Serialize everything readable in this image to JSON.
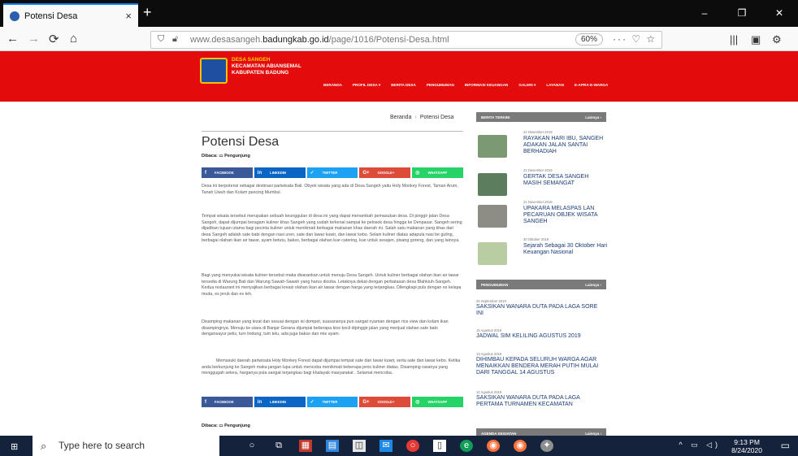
{
  "browser": {
    "tab_title": "Potensi Desa",
    "tab_close": "×",
    "new_tab": "+",
    "window_controls": [
      "–",
      "❐",
      "✕"
    ],
    "nav": {
      "back": "←",
      "forward": "→",
      "reload": "⟳",
      "home": "⌂"
    },
    "url_prefix": "www.desasangeh.",
    "url_domain": "badungkab.go.id",
    "url_path": "/page/1016/Potensi-Desa.html",
    "zoom": "60%",
    "url_actions": "··· ♡ ☆",
    "toolbar_icons": [
      "|||",
      "▣",
      "⚙"
    ]
  },
  "site": {
    "name_line1": "DESA SANGEH",
    "name_line2": "KECAMATAN ABIANSEMAL",
    "name_line3": "KABUPATEN BADUNG",
    "menu": [
      "BERANDA",
      "PROFIL DESA ▾",
      "BERITA DESA",
      "PENGUMUMAN",
      "INFORMASI KEUANGAN",
      "GALERI ▾",
      "LAYANAN",
      "E-APRA-E-WARGA"
    ],
    "accent_color": "#e30b0b"
  },
  "article": {
    "breadcrumb_home": "Beranda",
    "breadcrumb_sep": "›",
    "breadcrumb_current": "Potensi Desa",
    "title": "Potensi Desa",
    "view_label": "Dibaca: ▭ Pengunjung",
    "share": [
      {
        "icon": "f",
        "label": "FACEBOOK"
      },
      {
        "icon": "in",
        "label": "LINKEDIN"
      },
      {
        "icon": "✓",
        "label": "TWITTER"
      },
      {
        "icon": "G+",
        "label": "GOOGLE+"
      },
      {
        "icon": "◎",
        "label": "WHATSAPP"
      }
    ],
    "paragraphs": [
      "Desa ini berpotensi sebagai destinasi pariwisata Bali. Obyek wisata yang ada di Desa Sangeh yaitu Holy Monkey Forest, Taman Arum, Tanah Uwuh dan Kolam pancing Mumbul.",
      "Tempat wisata tersebut merupakan sebuah keunggulan di desa ini yang dapat menambah pemasukan desa. Di pinggir jalan Desa Sangeh, dapat dijumpai beragam kuliner khas Sangeh yang sudah terkenal sampai ke pelosok desa hingga ke Denpasar. Sangeh sering dijadikan tujuan utama bagi pecinta kuliner untuk menikmati berbagai makanan khas daerah ini. Salah satu makanan yang khas dari desa Sangeh adalah sate babi dengan nasi uren, sate dan lawar kuwir, dan lawar kebo. Selain kuliner diatas adapula nasi be guling, berbagai olahan ikan air tawar, ayam betutu, bakso, berbagai olahan kue catering, kue untuk sesajen, pisang goreng, dan yang lainnya.",
      "Bagi yang menyukai wisata kuliner tersebut maka disarankan untuk menuju Desa Sangeh. Untuk kuliner berbagai olahan ikan air tawar tersedia di Warung Bali dan Warung Sawah-Sawah yang harus dicoba. Letaknya dekat dengan perbatasan desa Blahkiuh-Sangeh. Kedua restaurant ini menyajikan berbagai kreasi olahan ikan air tawar dengan harga yang terjangkau. Dilengkapi pula dengan es kelapa muda, es jeruk dan es teh.",
      "Disamping makanan yang lezat dan sesuai dengan isi dompet, suasananya pun sangat nyaman dengan rice view dan kolam ikan disampingnya. Menuju ke utara di Banjar Gerana dijumpai beberapa kios kecil dipinggir jalan yang menjual olahan sate babi dengansayur pelis, tum lindung, tum telu, ada juga bakso dan mie ayam.",
      "Memasuki daerah pariwisata Holy Monkey Forest dapat dijumpai tempat sate dan lawar kuwir, serta sate dan lawar kebo. Ketika anda berkunjung ke Sangeh maka jangan lupa untuk mencoba menikmati beberapa jenis kuliner diatas. Disamping rasanya yang menggugah selera, harganya pula sangat terjangkau bagi khalayak masyarakat . Selamat mencoba."
    ]
  },
  "sidebar": {
    "news_header": "BERITA TERKINI",
    "more_label": "Lainnya ›",
    "news": [
      {
        "date": "22 Desember 2019",
        "title": "RAYAKAN HARI IBU, SANGEH ADAKAN JALAN SANTAI BERHADIAH",
        "thumb_color": "#7b9a74"
      },
      {
        "date": "22 Desember 2019",
        "title": "GERTAK DESA SANGEH MASIH SEMANGAT",
        "thumb_color": "#5c7d5e"
      },
      {
        "date": "21 November 2019",
        "title": "UPAKARA MELASPAS LAN PECARUAN OBJEK WISATA SANGEH",
        "thumb_color": "#8d8d86"
      },
      {
        "date": "30 Oktober 2019",
        "title": "Sejarah Sebagai 30 Oktober Hari Keuangan Nasional",
        "thumb_color": "#b9cda2"
      }
    ],
    "ann_header": "PENGUMUMAN",
    "announcements": [
      {
        "date": "26 September 2019",
        "title": "SAKSIKAN WANARA DUTA PADA LAGA SORE INI"
      },
      {
        "date": "15 Agustus 2019",
        "title": "JADWAL SIM KELILING AGUSTUS 2019"
      },
      {
        "date": "13 Agustus 2019",
        "title": "DIHIMBAU KEPADA SELURUH WARGA AGAR MENAIKKAN BENDERA MERAH PUTIH MULAI DARI TANGGAL 14 AGUSTUS"
      },
      {
        "date": "12 Agustus 2019",
        "title": "SAKSIKAN WANARA DUTA PADA LAGA PERTAMA TURNAMEN KECAMATAN"
      }
    ],
    "agenda_header": "AGENDA KEGIATAN"
  },
  "taskbar": {
    "search_placeholder": "Type here to search",
    "time": "9:13 PM",
    "date": "8/24/2020"
  }
}
